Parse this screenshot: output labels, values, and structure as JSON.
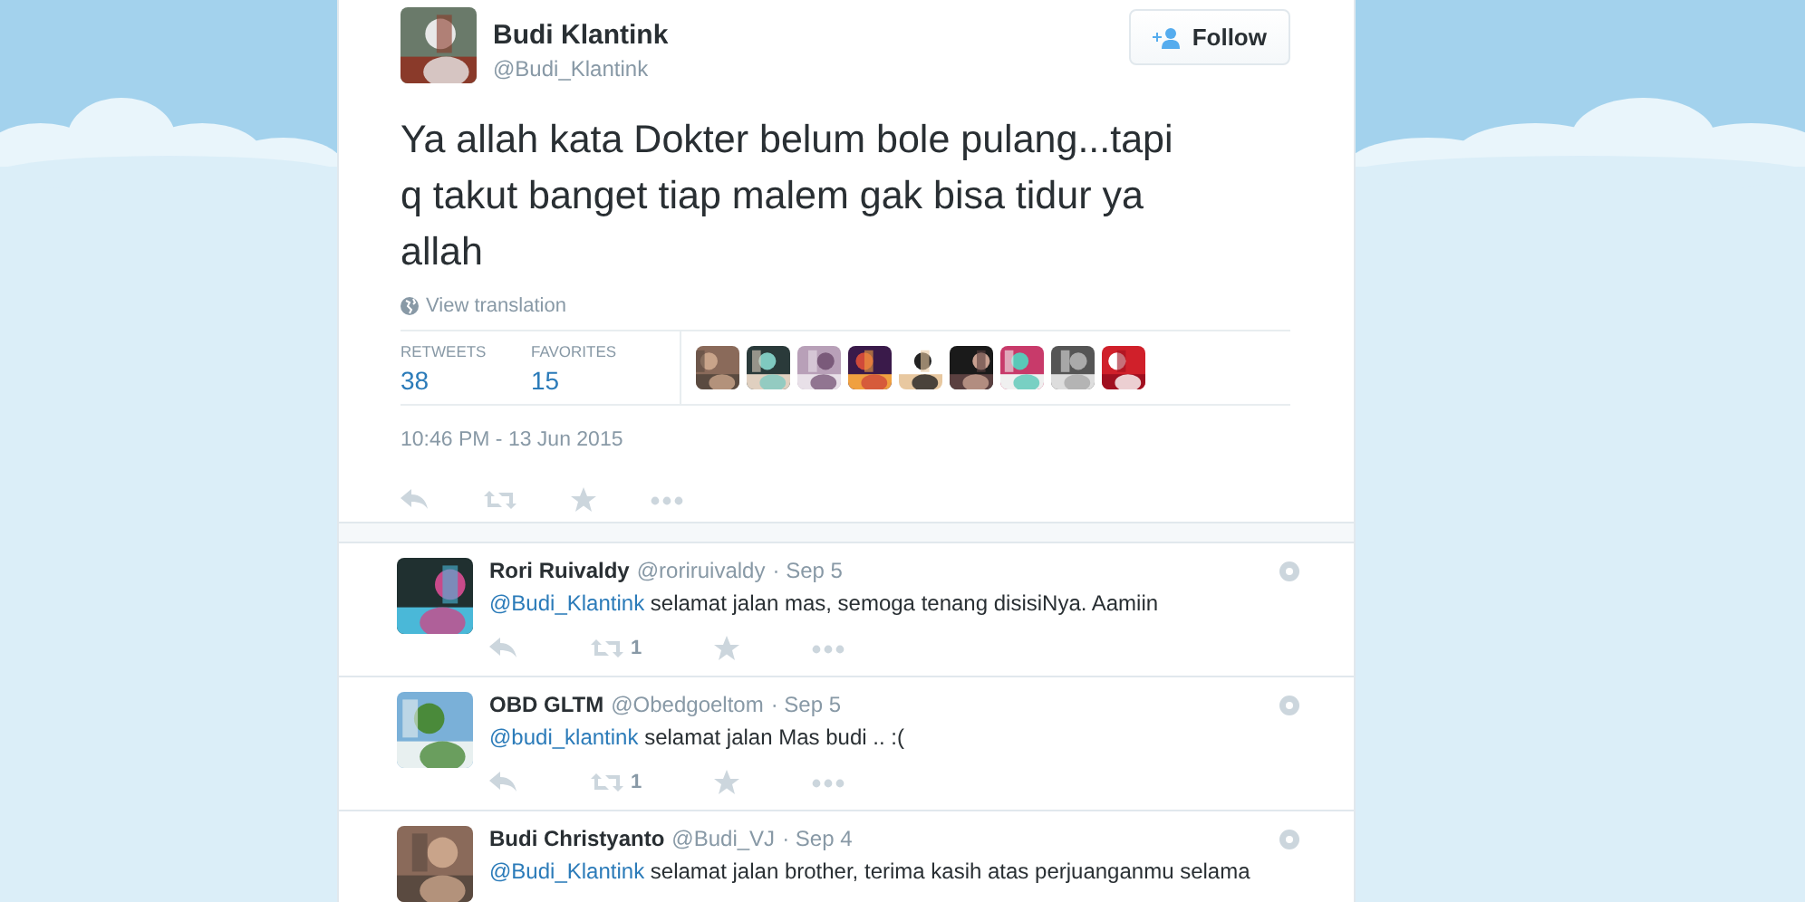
{
  "tweet": {
    "author": {
      "name": "Budi Klantink",
      "handle": "@Budi_Klantink"
    },
    "follow_button": {
      "label": "Follow"
    },
    "text": "Ya allah kata Dokter belum bole pulang...tapi q takut banget tiap malem gak bisa tidur ya allah",
    "translation_link": "View translation",
    "stats": [
      {
        "label": "RETWEETS",
        "value": "38"
      },
      {
        "label": "FAVORITES",
        "value": "15"
      }
    ],
    "timestamp": "10:46 PM - 13 Jun 2015"
  },
  "replies": [
    {
      "name": "Rori Ruivaldy",
      "handle": "@roriruivaldy",
      "time": "· Sep 5",
      "mention": "@Budi_Klantink",
      "text": " selamat jalan mas, semoga tenang disisiNya. Aamiin",
      "retweets": "1"
    },
    {
      "name": "OBD GLTM",
      "handle": "@Obedgoeltom",
      "time": "· Sep 5",
      "mention": "@budi_klantink",
      "text": " selamat jalan Mas budi .. :(",
      "retweets": "1"
    },
    {
      "name": "Budi Christyanto",
      "handle": "@Budi_VJ",
      "time": "· Sep 4",
      "mention": "@Budi_Klantink",
      "text": " selamat jalan brother, terima kasih atas perjuanganmu selama"
    }
  ]
}
